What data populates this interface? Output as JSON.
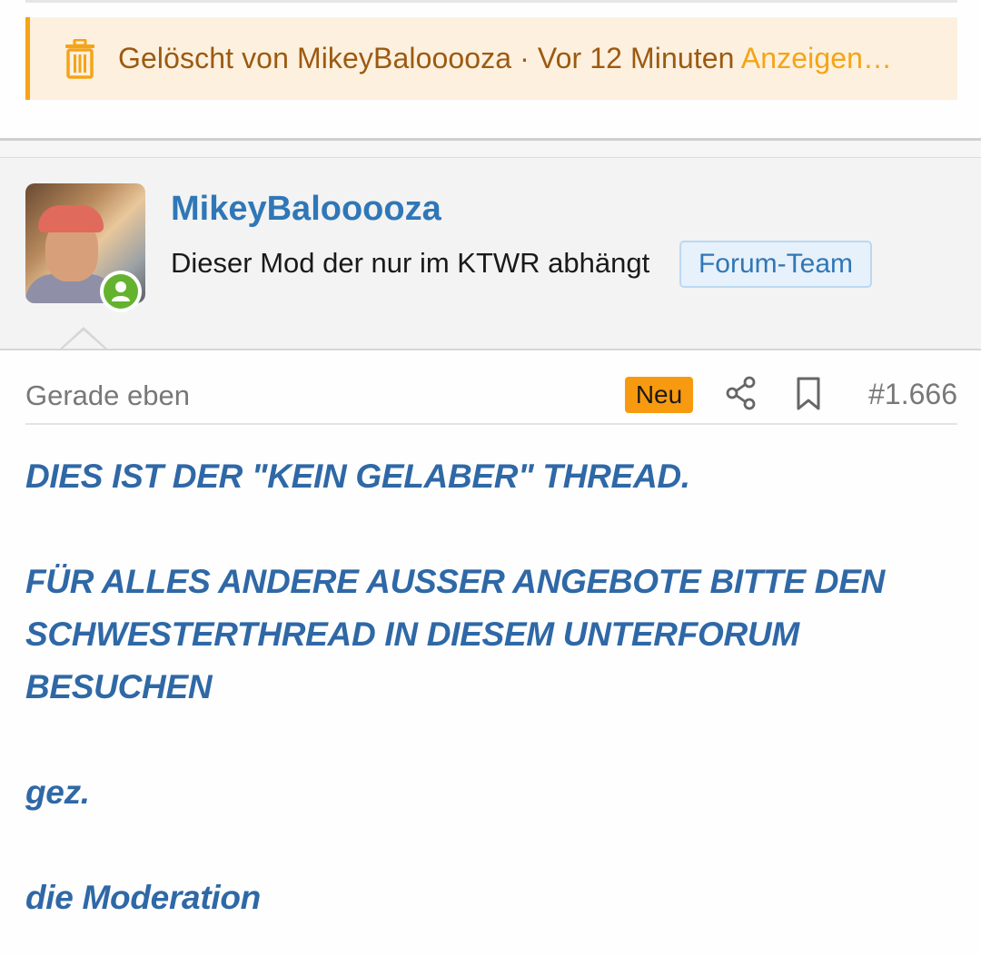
{
  "deleted_notice": {
    "text": "Gelöscht von MikeyBalooooza · Vor 12 Minuten",
    "link": "Anzeigen…",
    "icon": "trash-icon"
  },
  "author": {
    "username": "MikeyBalooooza",
    "title": "Dieser Mod der nur im KTWR abhängt",
    "role_badge": "Forum-Team",
    "status": "online"
  },
  "post": {
    "timestamp": "Gerade eben",
    "new_badge": "Neu",
    "number": "#1.666",
    "body": {
      "line1": "DIES IST DER \"KEIN GELABER\" THREAD.",
      "line2": "FÜR ALLES ANDERE AUSSER ANGEBOTE BITTE DEN",
      "line3": "SCHWESTERTHREAD IN DIESEM UNTERFORUM",
      "line4": "BESUCHEN",
      "line5": "gez.",
      "line6": "die Moderation"
    }
  },
  "colors": {
    "accent": "#2f77b7",
    "warning": "#f5a417",
    "online": "#63b32e",
    "new_badge": "#f89a0f"
  }
}
